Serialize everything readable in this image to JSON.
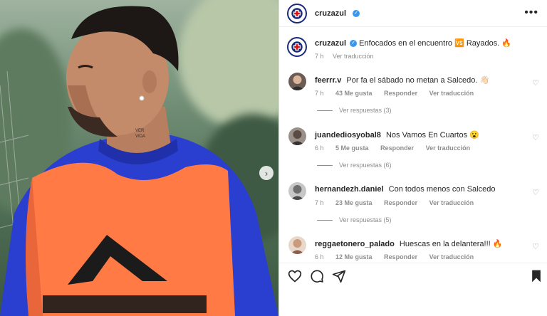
{
  "header": {
    "username": "cruzazul",
    "verified_glyph": "✓",
    "more_glyph": "•••"
  },
  "photo": {
    "next_glyph": "›"
  },
  "caption": {
    "username": "cruzazul",
    "text_before": "Enfocados en el encuentro",
    "emoji_vs": "🆚",
    "text_after": "Rayados.",
    "emoji_fire": "🔥",
    "time": "7 h",
    "translate": "Ver traducción"
  },
  "comments": [
    {
      "username": "feerrr.v",
      "text": "Por fa el sábado no metan a Salcedo. 👋🏻",
      "time": "7 h",
      "likes": "43 Me gusta",
      "reply": "Responder",
      "translate": "Ver traducción",
      "replies": "Ver respuestas (3)"
    },
    {
      "username": "juandediosyobal8",
      "text": "Nos Vamos En Cuartos 😮",
      "time": "6 h",
      "likes": "5 Me gusta",
      "reply": "Responder",
      "translate": "Ver traducción",
      "replies": "Ver respuestas (6)"
    },
    {
      "username": "hernandezh.daniel",
      "text": "Con todos menos con Salcedo",
      "time": "7 h",
      "likes": "23 Me gusta",
      "reply": "Responder",
      "translate": "Ver traducción",
      "replies": "Ver respuestas (5)"
    },
    {
      "username": "reggaetonero_palado",
      "text": "Huescas en la delantera!!! 🔥",
      "time": "6 h",
      "likes": "12 Me gusta",
      "reply": "Responder",
      "translate": "Ver traducción",
      "replies": ""
    }
  ],
  "icons": {
    "heart": "heart-icon",
    "comment": "comment-icon",
    "share": "share-icon",
    "save": "bookmark-icon"
  },
  "colors": {
    "brand_blue": "#1a2a7a",
    "verified": "#3897f0",
    "vest_orange": "#ff7a45",
    "jersey_blue": "#2a3fd0"
  }
}
